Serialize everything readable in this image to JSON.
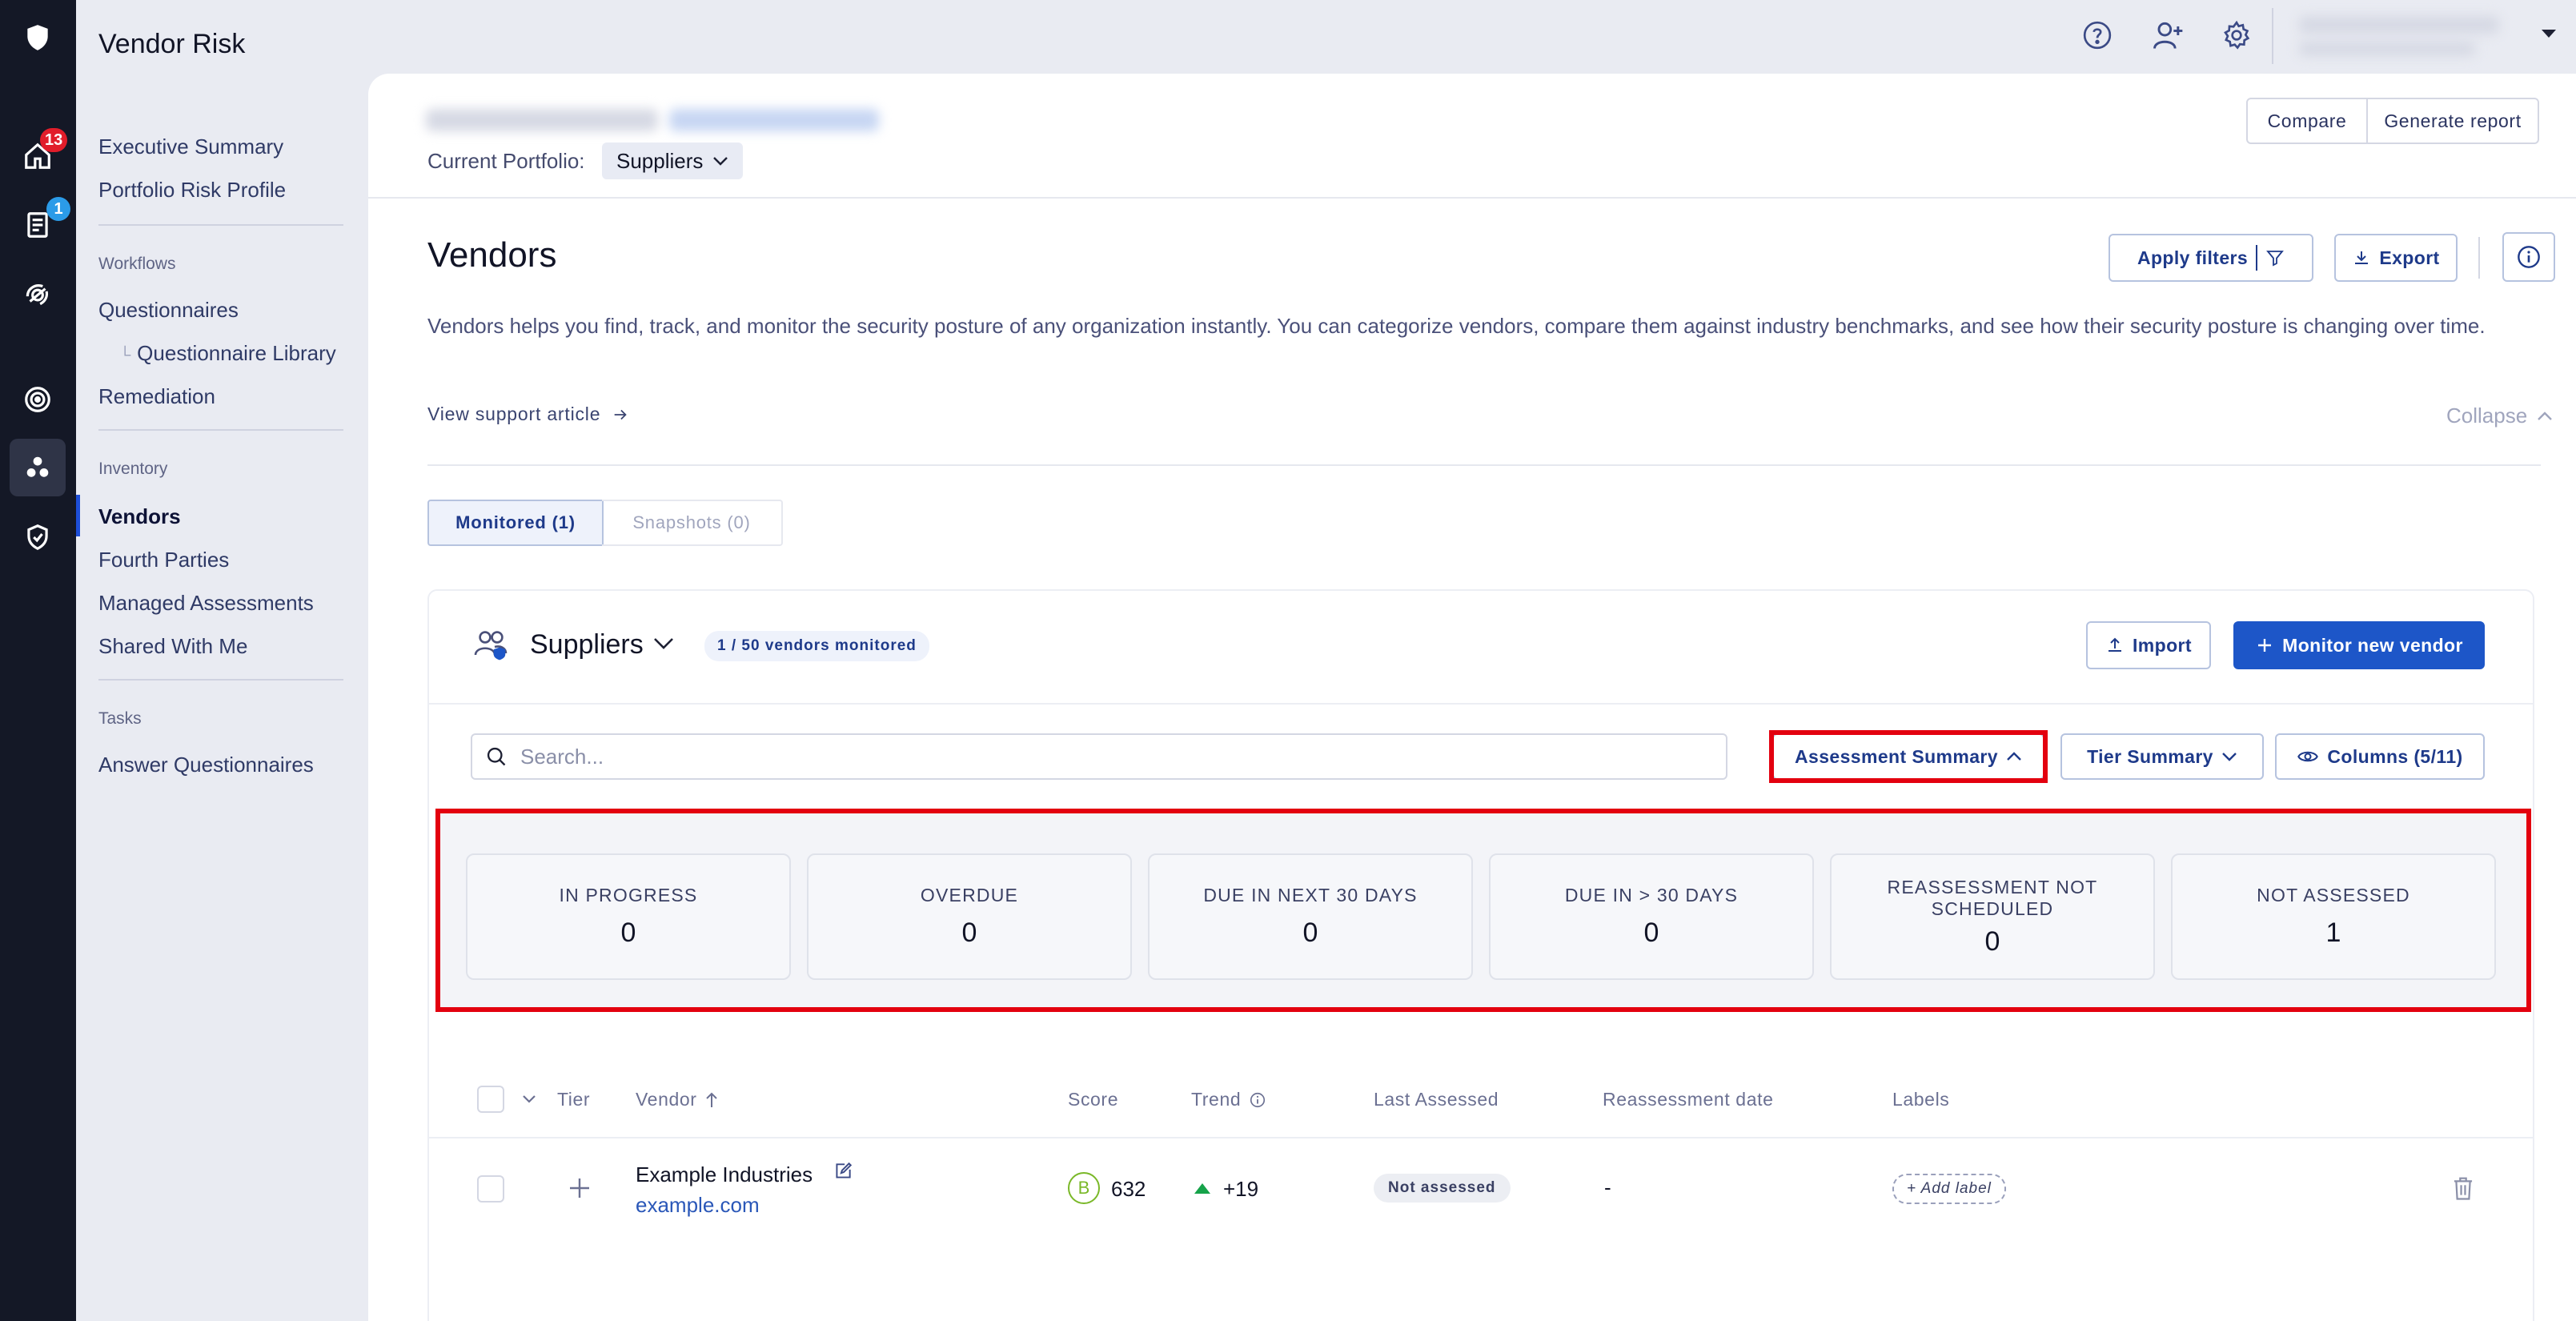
{
  "rail": {
    "badges": {
      "home": "13",
      "document": "1"
    }
  },
  "nav": {
    "app_title": "Vendor Risk",
    "items_top": [
      "Executive Summary",
      "Portfolio Risk Profile"
    ],
    "workflows_label": "Workflows",
    "workflows": [
      "Questionnaires",
      "Questionnaire Library",
      "Remediation"
    ],
    "inventory_label": "Inventory",
    "inventory": [
      "Vendors",
      "Fourth Parties",
      "Managed Assessments",
      "Shared With Me"
    ],
    "tasks_label": "Tasks",
    "tasks": [
      "Answer Questionnaires"
    ]
  },
  "header": {
    "portfolio_label": "Current Portfolio:",
    "portfolio_value": "Suppliers",
    "compare": "Compare",
    "generate_report": "Generate report"
  },
  "page": {
    "title": "Vendors",
    "apply_filters": "Apply filters",
    "export": "Export",
    "description": "Vendors helps you find, track, and monitor the security posture of any organization instantly. You can categorize vendors, compare them against industry benchmarks, and see how their security posture is changing over time.",
    "support_link": "View support article",
    "collapse": "Collapse",
    "tabs": [
      {
        "label": "Monitored (1)",
        "active": true
      },
      {
        "label": "Snapshots (0)",
        "active": false
      }
    ]
  },
  "portfolio_card": {
    "name": "Suppliers",
    "monitored_badge": "1 / 50 vendors monitored",
    "import": "Import",
    "monitor_new": "Monitor new vendor",
    "search_placeholder": "Search...",
    "assessment_summary": "Assessment Summary",
    "tier_summary": "Tier Summary",
    "columns": "Columns (5/11)"
  },
  "summary": [
    {
      "label": "IN PROGRESS",
      "value": "0"
    },
    {
      "label": "OVERDUE",
      "value": "0"
    },
    {
      "label": "DUE IN NEXT 30 DAYS",
      "value": "0"
    },
    {
      "label": "DUE IN > 30 DAYS",
      "value": "0"
    },
    {
      "label": "REASSESSMENT NOT SCHEDULED",
      "value": "0"
    },
    {
      "label": "NOT ASSESSED",
      "value": "1"
    }
  ],
  "table": {
    "headers": [
      "Tier",
      "Vendor",
      "Score",
      "Trend",
      "Last Assessed",
      "Reassessment date",
      "Labels"
    ],
    "rows": [
      {
        "vendor": "Example Industries",
        "domain": "example.com",
        "grade": "B",
        "score": "632",
        "trend": "+19",
        "last_assessed": "Not assessed",
        "reassessment": "-",
        "add_label": "+ Add label"
      }
    ]
  },
  "colors": {
    "accent": "#1d56c8",
    "highlight": "#e3000f",
    "rail": "#141826",
    "trend_up": "#16a34a",
    "grade_b": "#7ab828"
  }
}
